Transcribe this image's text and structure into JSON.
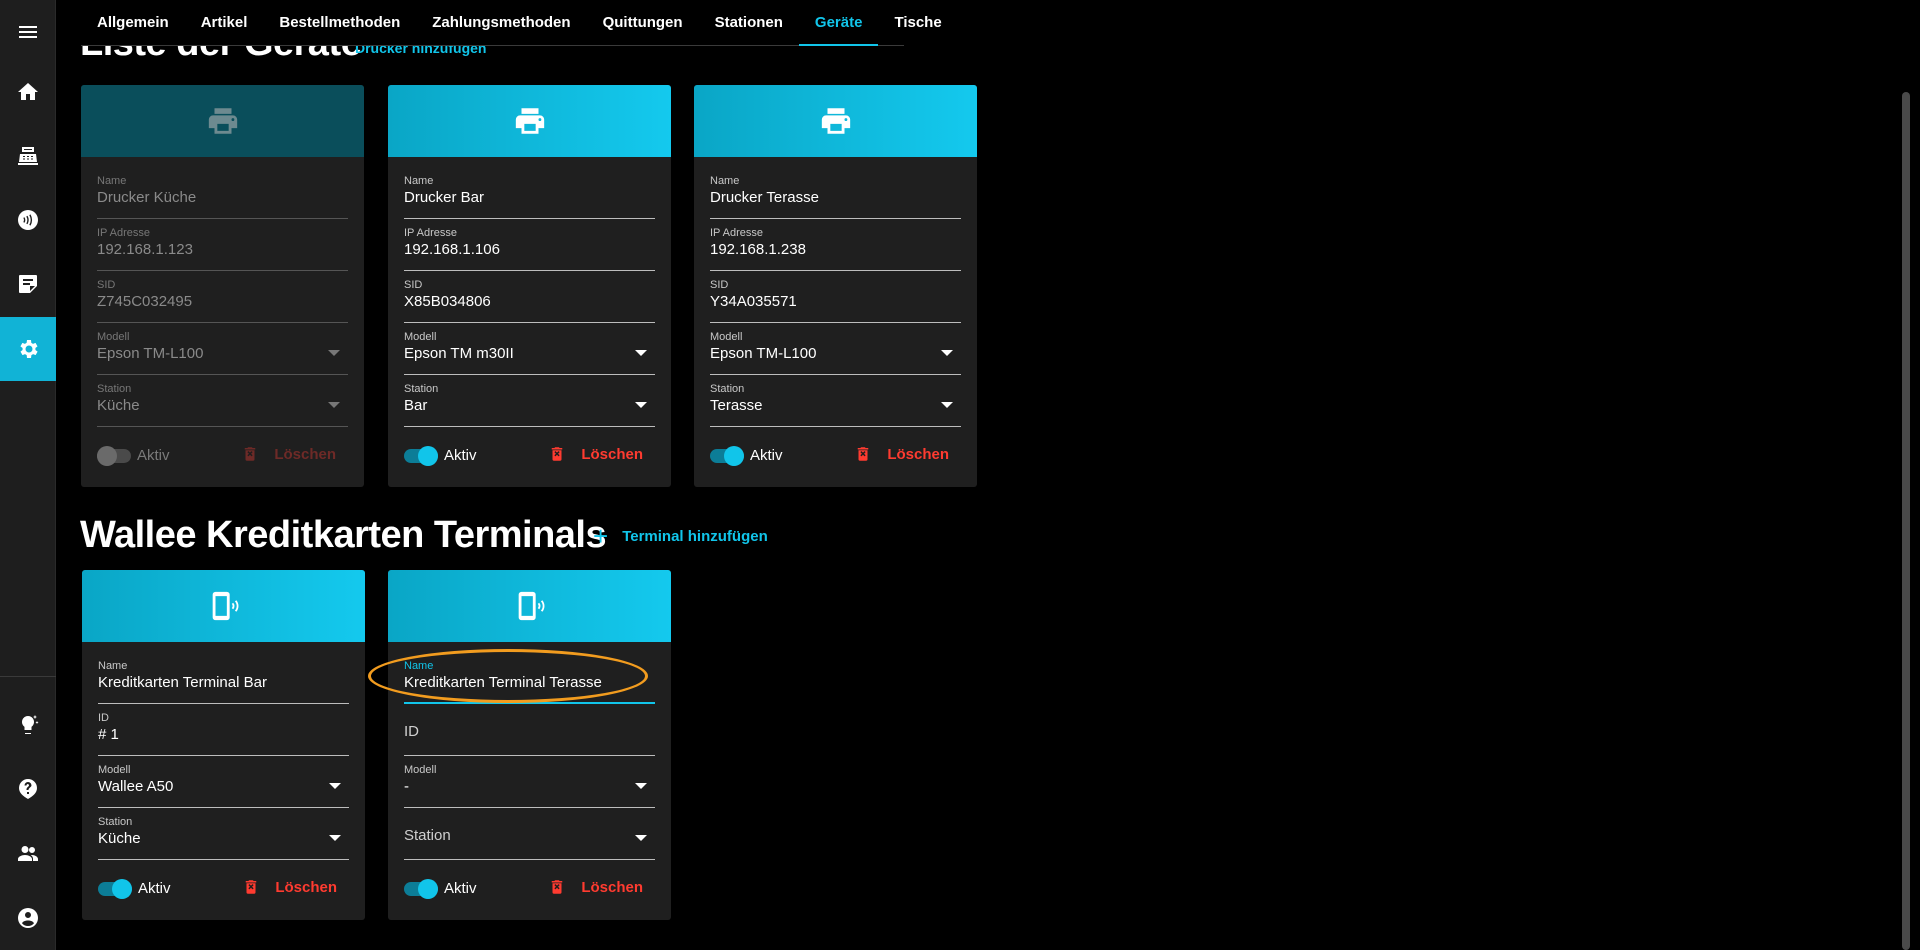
{
  "tabs": [
    "Allgemein",
    "Artikel",
    "Bestellmethoden",
    "Zahlungsmethoden",
    "Quittungen",
    "Stationen",
    "Geräte",
    "Tische"
  ],
  "active_tab": "Geräte",
  "printers_section": {
    "title": "Liste der Geräte",
    "add_label": "Drucker hinzufügen"
  },
  "printers": [
    {
      "name_label": "Name",
      "name": "Drucker Küche",
      "ip_label": "IP Adresse",
      "ip": "192.168.1.123",
      "sid_label": "SID",
      "sid": "Z745C032495",
      "model_label": "Modell",
      "model": "Epson TM-L100",
      "station_label": "Station",
      "station": "Küche",
      "active_label": "Aktiv",
      "active": false,
      "delete_label": "Löschen"
    },
    {
      "name_label": "Name",
      "name": "Drucker Bar",
      "ip_label": "IP Adresse",
      "ip": "192.168.1.106",
      "sid_label": "SID",
      "sid": "X85B034806",
      "model_label": "Modell",
      "model": "Epson TM m30II",
      "station_label": "Station",
      "station": "Bar",
      "active_label": "Aktiv",
      "active": true,
      "delete_label": "Löschen"
    },
    {
      "name_label": "Name",
      "name": "Drucker Terasse",
      "ip_label": "IP Adresse",
      "ip": "192.168.1.238",
      "sid_label": "SID",
      "sid": "Y34A035571",
      "model_label": "Modell",
      "model": "Epson TM-L100",
      "station_label": "Station",
      "station": "Terasse",
      "active_label": "Aktiv",
      "active": true,
      "delete_label": "Löschen"
    }
  ],
  "terminals_section": {
    "title": "Wallee Kreditkarten Terminals",
    "add_label": "Terminal hinzufügen"
  },
  "terminals": [
    {
      "name_label": "Name",
      "name": "Kreditkarten Terminal Bar",
      "id_label": "ID",
      "id": "# 1",
      "model_label": "Modell",
      "model": "Wallee A50",
      "station_label": "Station",
      "station": "Küche",
      "active_label": "Aktiv",
      "active": true,
      "delete_label": "Löschen"
    },
    {
      "name_label": "Name",
      "name": "Kreditkarten Terminal Terasse",
      "id_label": "ID",
      "id": "",
      "model_label": "Modell",
      "model": "-",
      "station_label": "Station",
      "station": "",
      "active_label": "Aktiv",
      "active": true,
      "delete_label": "Löschen"
    }
  ],
  "colors": {
    "accent": "#11c5ea",
    "danger": "#ff3b30",
    "highlight": "#f29c1f",
    "background": "#000000",
    "card": "#1f1f1f"
  },
  "icons": [
    "menu-icon",
    "home-icon",
    "cash-register-icon",
    "contactless-icon",
    "note-icon",
    "gear-icon",
    "lightbulb-icon",
    "help-icon",
    "users-icon",
    "account-icon",
    "printer-icon",
    "phone-terminal-icon",
    "trash-icon",
    "plus-icon"
  ]
}
